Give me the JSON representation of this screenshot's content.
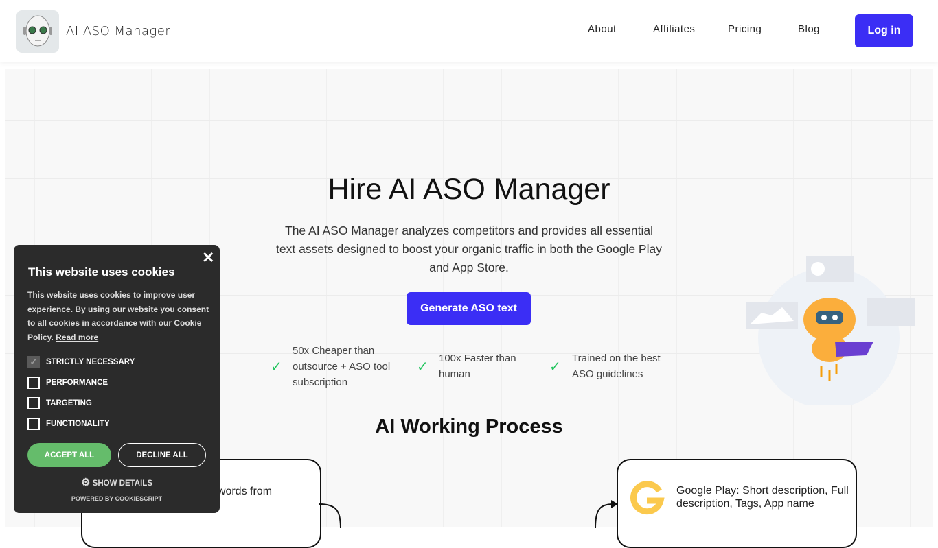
{
  "header": {
    "brand": "AI ASO Manager",
    "nav": [
      "About",
      "Affiliates",
      "Pricing",
      "Blog"
    ],
    "login": "Log in"
  },
  "hero": {
    "title": "Hire AI ASO Manager",
    "subtitle": "The AI ASO Manager analyzes competitors and provides all essential text assets designed to boost your organic traffic in both the Google Play and App Store.",
    "cta": "Generate ASO text",
    "features": [
      "50x Cheaper than outsource + ASO tool subscription",
      "100x Faster than human",
      "Trained on the best ASO guidelines"
    ]
  },
  "process": {
    "title": "AI Working Process",
    "box1": "eywords from",
    "box2": "Google Play: Short description, Full description, Tags, App name"
  },
  "cookie": {
    "title": "This website uses cookies",
    "desc": "This website uses cookies to improve user experience. By using our website you consent to all cookies in accordance with our Cookie Policy.",
    "read_more": "Read more",
    "options": [
      {
        "label": "STRICTLY NECESSARY",
        "checked": true
      },
      {
        "label": "PERFORMANCE",
        "checked": false
      },
      {
        "label": "TARGETING",
        "checked": false
      },
      {
        "label": "FUNCTIONALITY",
        "checked": false
      }
    ],
    "accept": "ACCEPT ALL",
    "decline": "DECLINE ALL",
    "show_details": "SHOW DETAILS",
    "powered": "POWERED BY COOKIESCRIPT"
  },
  "colors": {
    "accent": "#3b2ef5",
    "accept": "#65bc6b",
    "check": "#22c55e",
    "google": "#fbc94d"
  }
}
